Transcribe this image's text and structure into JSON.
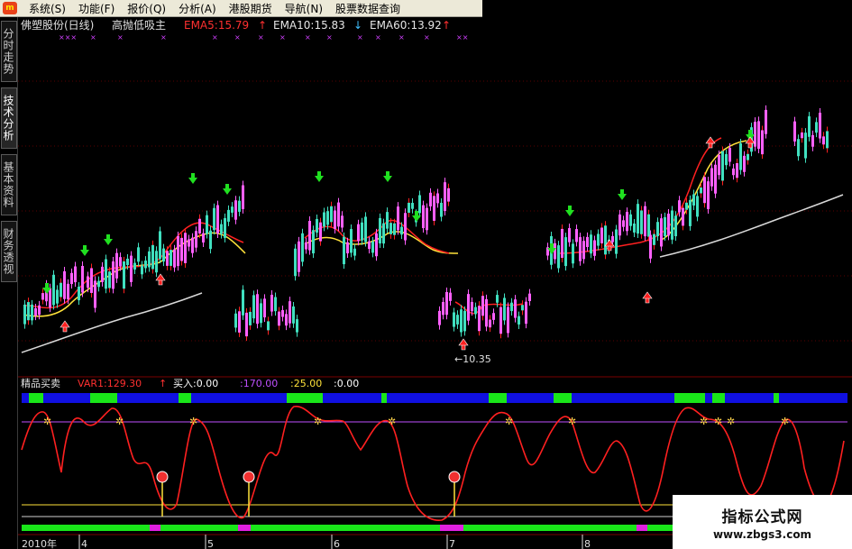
{
  "menubar": {
    "logo_text": "m",
    "items": [
      {
        "label": "系统(S)"
      },
      {
        "label": "功能(F)"
      },
      {
        "label": "报价(Q)"
      },
      {
        "label": "分析(A)"
      },
      {
        "label": "港股期货"
      },
      {
        "label": "导航(N)"
      },
      {
        "label": "股票数据查询"
      }
    ]
  },
  "sidebar": {
    "tabs": [
      {
        "label": "分时走势",
        "active": false
      },
      {
        "label": "技术分析",
        "active": true
      },
      {
        "label": "基本资料",
        "active": false
      },
      {
        "label": "财务透视",
        "active": false
      }
    ]
  },
  "main_chart": {
    "title": "佛塑股份(日线)",
    "indicator_name": "高抛低吸主",
    "ema5_label": "EMA5:15.79",
    "ema10_label": "EMA10:15.83",
    "ema60_label": "EMA60:13.92",
    "ema5_color": "#ff3030",
    "ema10_color": "#e6e6e6",
    "ema60_color": "#e6e6e6",
    "low_annotation": "←10.35"
  },
  "sub_chart": {
    "name": "精品买卖",
    "var1_label": "VAR1:129.30",
    "buy_label": "买入:0.00",
    "v170_label": ":170.00",
    "v25_label": ":25.00",
    "v0_label": ":0.00",
    "var1_color": "#ff3030",
    "buy_color": "#ffffff",
    "v170_color": "#c050ff",
    "v25_color": "#ffe23a",
    "v0_color": "#ffffff"
  },
  "time_axis": {
    "year_label": "2010年",
    "months": [
      "4",
      "5",
      "6",
      "7",
      "8"
    ]
  },
  "watermark": {
    "title": "指标公式网",
    "url": "www.zbgs3.com"
  }
}
